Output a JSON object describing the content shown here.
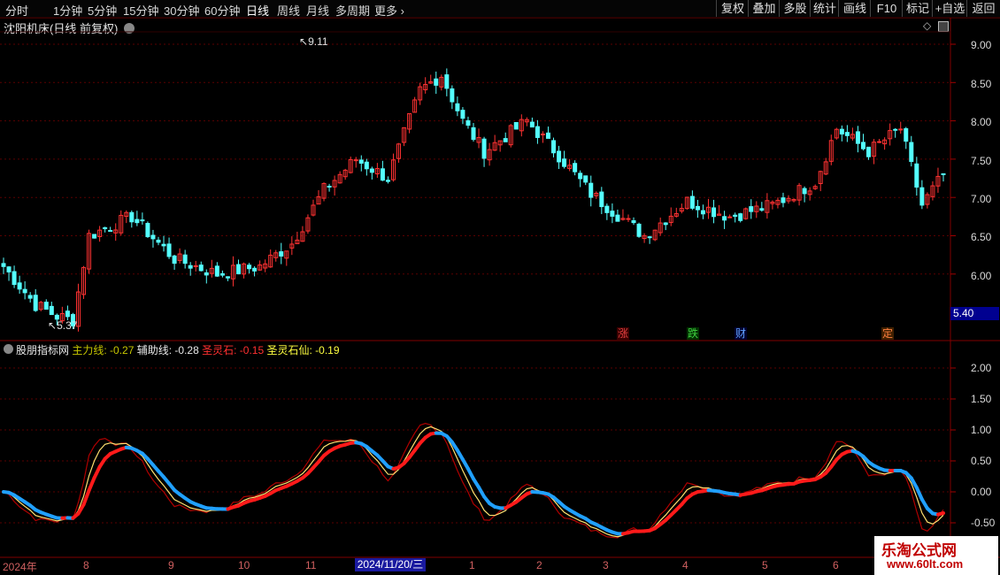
{
  "toolbar": {
    "periods": [
      "分时",
      "1分钟",
      "5分钟",
      "15分钟",
      "30分钟",
      "60分钟",
      "日线",
      "周线",
      "月线",
      "多周期",
      "更多"
    ],
    "more_chevron": "›",
    "tools": [
      "复权",
      "叠加",
      "多股",
      "统计",
      "画线",
      "F10",
      "标记",
      "+自选",
      "返回"
    ]
  },
  "stock": {
    "title": "沈阳机床(日线 前复权)",
    "high_marker": "9.11",
    "low_marker": "5.37"
  },
  "price_axis": {
    "labels": [
      "9.00",
      "8.50",
      "8.00",
      "7.50",
      "7.00",
      "6.50",
      "6.00"
    ],
    "current_price": "5.40"
  },
  "events": [
    {
      "label": "涨",
      "color": "#e04040",
      "bg": "#3a0000"
    },
    {
      "label": "跌",
      "color": "#40d040",
      "bg": "#003000"
    },
    {
      "label": "财",
      "color": "#60a0ff",
      "bg": "#000030"
    },
    {
      "label": "定",
      "color": "#ff8040",
      "bg": "#402000"
    }
  ],
  "indicator": {
    "name": "股朋指标网",
    "values": [
      {
        "label": "主力线: -0.27",
        "color": "#c8c800"
      },
      {
        "label": "辅助线: -0.28",
        "color": "#e8e8e8"
      },
      {
        "label": "圣灵石: -0.15",
        "color": "#ff3030"
      },
      {
        "label": "圣灵石仙: -0.19",
        "color": "#ffff40"
      }
    ],
    "axis_labels": [
      "2.00",
      "1.50",
      "1.00",
      "0.50",
      "0.00",
      "-0.50"
    ]
  },
  "dates": {
    "labels": [
      "2024年",
      "8",
      "9",
      "10",
      "11",
      "1",
      "2",
      "3",
      "4",
      "5",
      "6"
    ],
    "selected": "2024/11/20/三"
  },
  "watermark": {
    "line1": "乐淘公式网",
    "line2": "www.60lt.com"
  },
  "colors": {
    "up": "#ff3232",
    "down": "#54ffff",
    "grid": "#5a0000",
    "bg": "#000000"
  }
}
